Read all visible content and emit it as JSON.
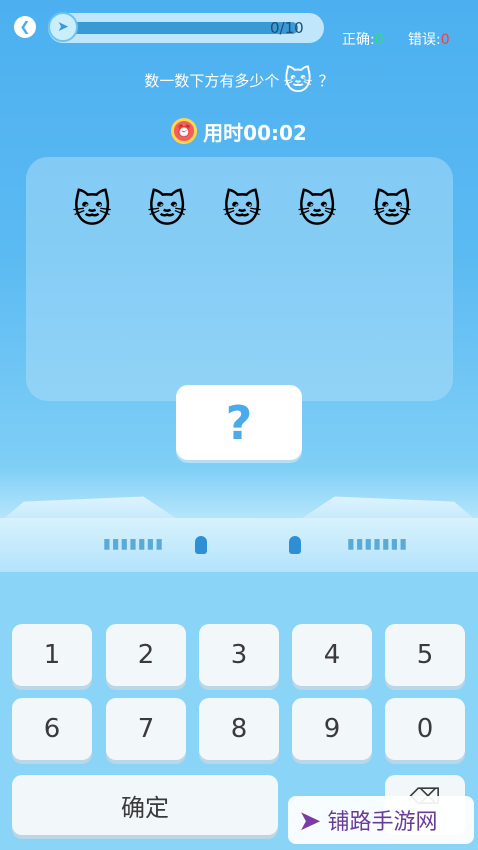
{
  "header": {
    "back_icon": "back-arrow-icon",
    "progress_text": "0/10",
    "progress_value": 0.0,
    "correct_label": "正确:",
    "correct_value": "0",
    "wrong_label": "错误:",
    "wrong_value": "0"
  },
  "question": {
    "prefix": "数一数下方有多少个",
    "suffix": "？",
    "icon": "cat-icon"
  },
  "timer": {
    "icon": "alarm-clock-icon",
    "label": "用时00:02"
  },
  "panel": {
    "cat_count": 5,
    "cats": [
      "🐱",
      "🐱",
      "🐱",
      "🐱",
      "🐱"
    ]
  },
  "answer": {
    "value": "?"
  },
  "keypad": {
    "row1": [
      "1",
      "2",
      "3",
      "4",
      "5"
    ],
    "row2": [
      "6",
      "7",
      "8",
      "9",
      "0"
    ],
    "confirm_label": "确定"
  },
  "watermark": {
    "text": "铺路手游网"
  },
  "colors": {
    "accent": "#4aaaea",
    "correct": "#29e36b",
    "wrong": "#ff3b3b"
  }
}
